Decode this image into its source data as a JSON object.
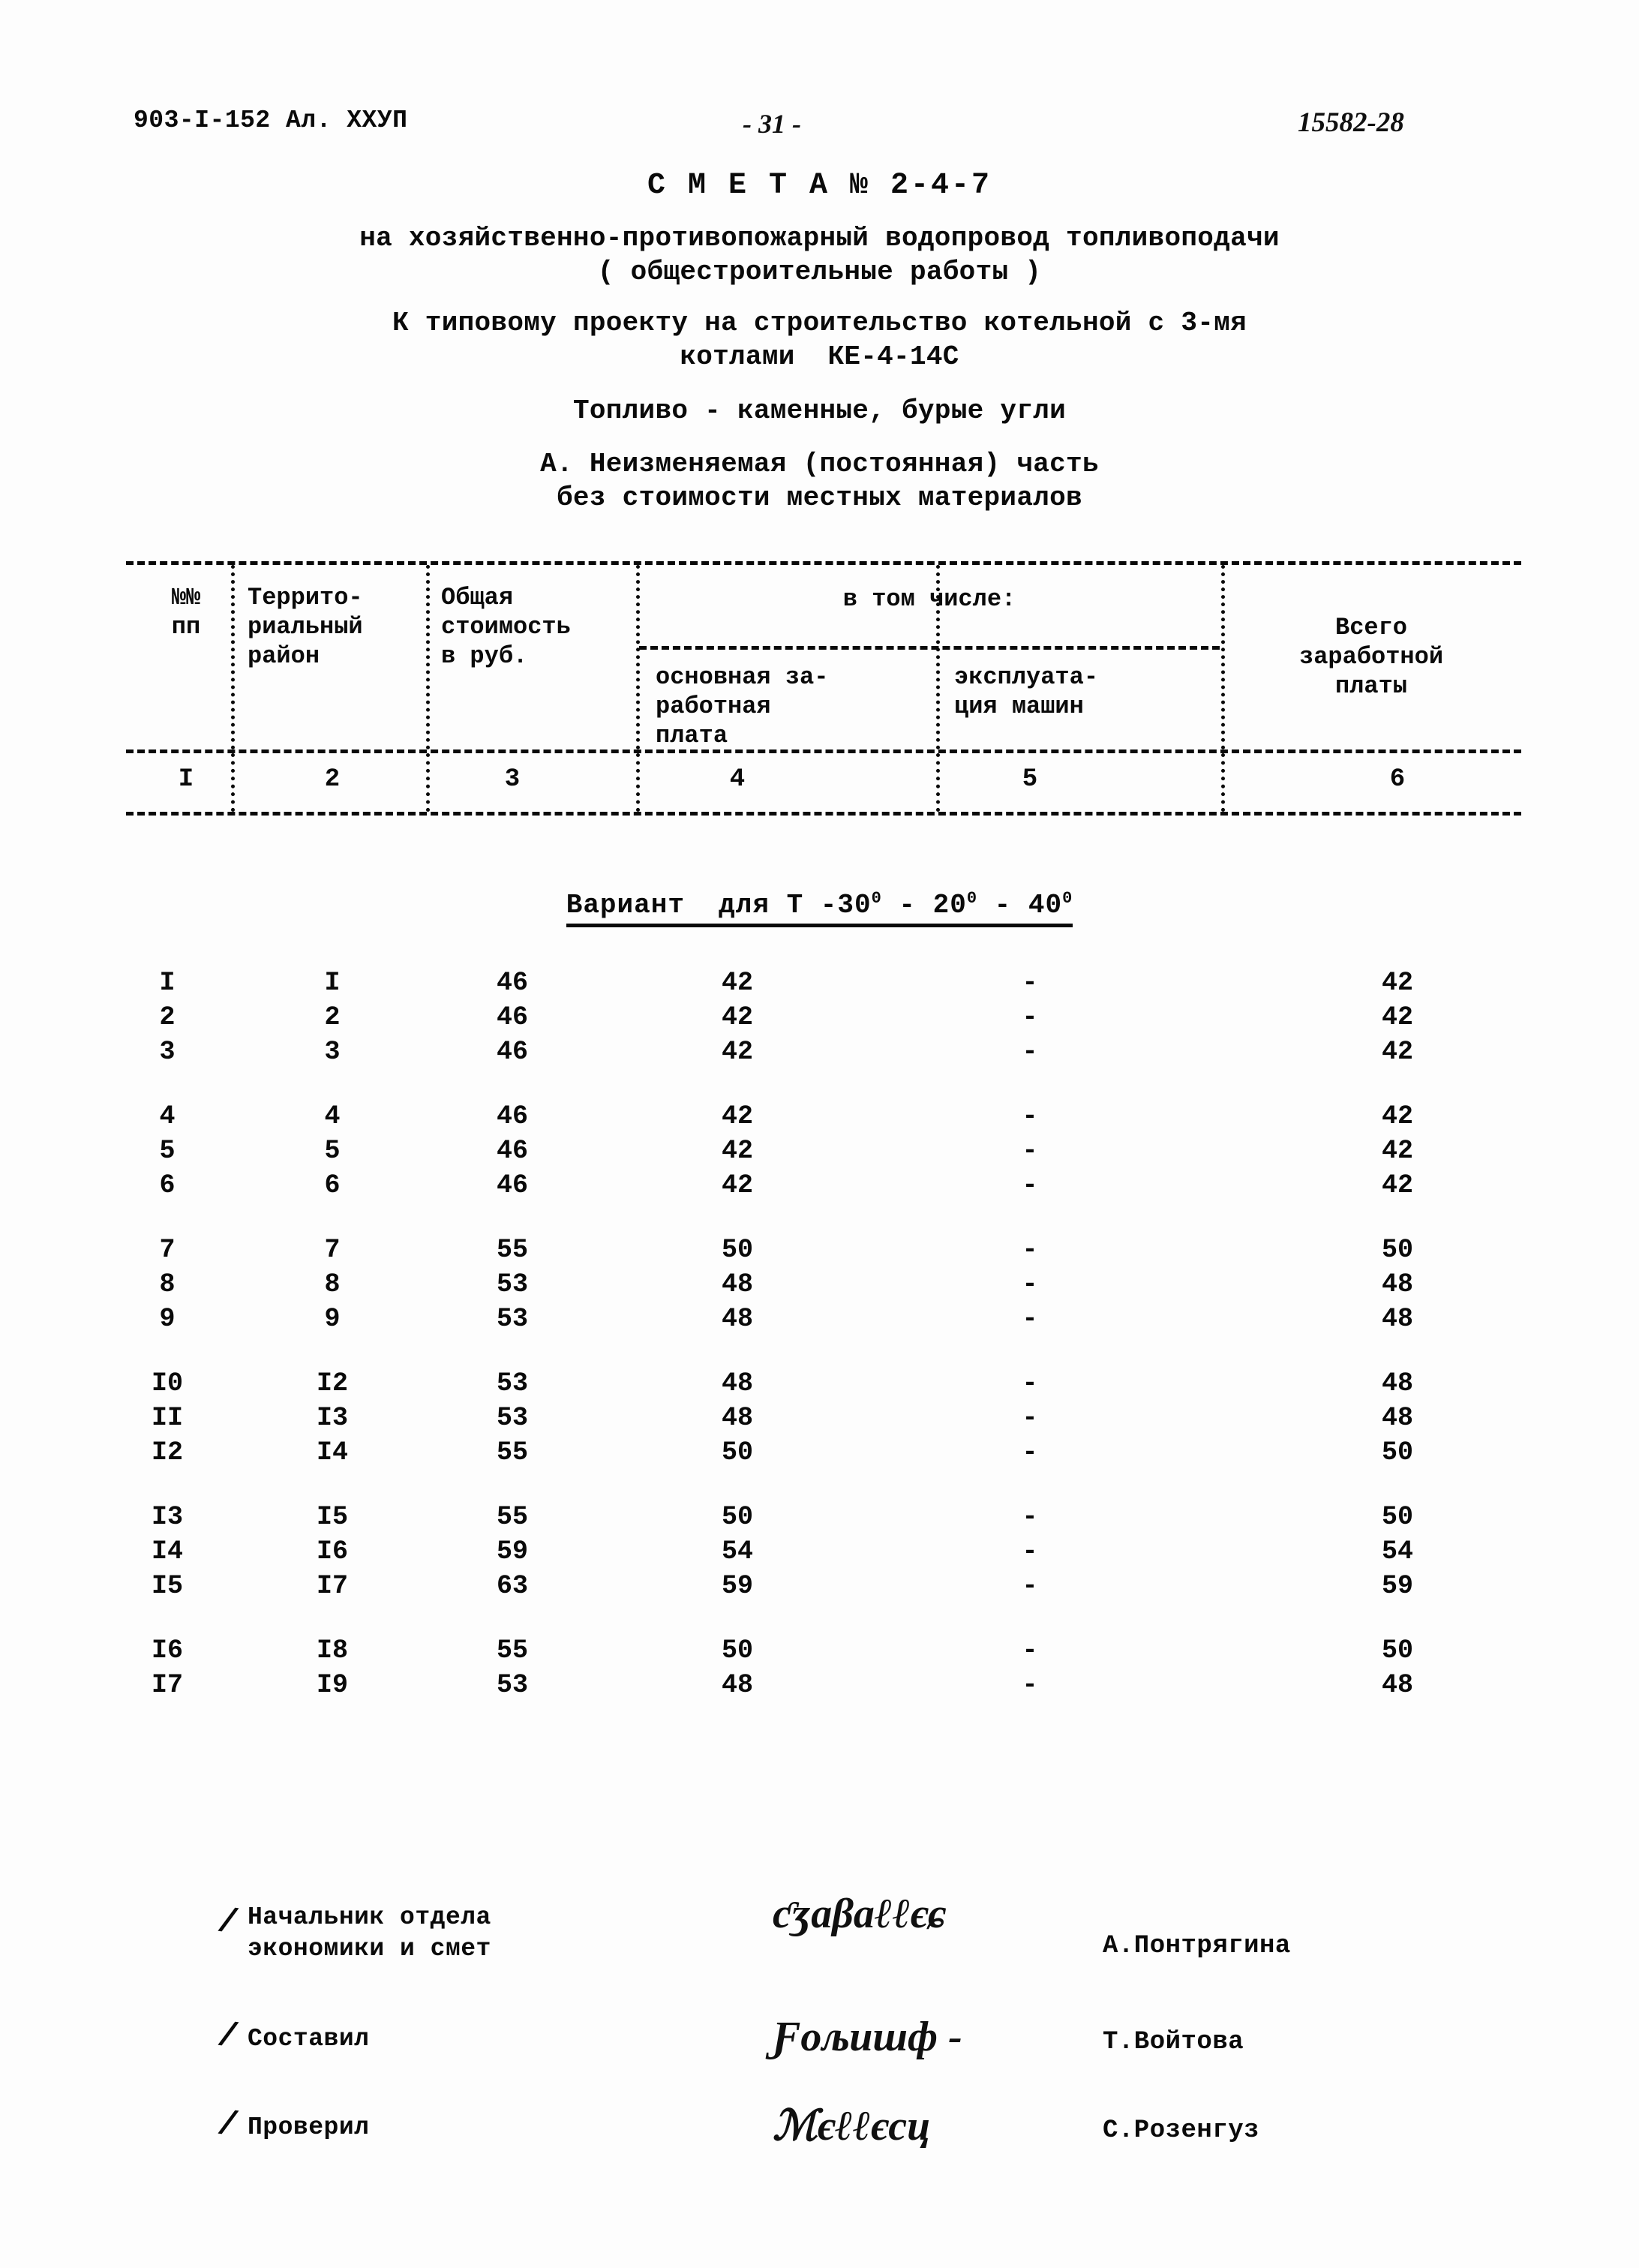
{
  "header": {
    "left": "903-I-152 Ал. ХХУП",
    "page": "- 31 -",
    "right": "15582-28"
  },
  "title": {
    "smeta": "С М Е Т А № 2-4-7",
    "line1": "на хозяйственно-противопожарный водопровод топливоподачи",
    "line2": "( общестроительные работы )",
    "line3": "К типовому проекту на строительство котельной с 3-мя",
    "line4": "котлами  КЕ-4-14С",
    "line5": "Топливо - каменные, бурые угли",
    "line6": "А. Неизменяемая (постоянная) часть",
    "line7": "без стоимости местных материалов"
  },
  "table": {
    "headers": {
      "col1": "№№\nпп",
      "col2": "Террито-\nриальный\nрайон",
      "col3": "Общая\nстоимость\nв руб.",
      "group": "в том числе:",
      "col4": "основная за-\nработная\nплата",
      "col5": "эксплуата-\nция машин",
      "col6": "Всего\nзаработной\nплаты"
    },
    "numbering": [
      "I",
      "2",
      "3",
      "4",
      "5",
      "6"
    ],
    "variant": {
      "label": "Вариант  для Т -30",
      "deg1": "0",
      "mid1": " - 20",
      "deg2": "0",
      "mid2": " - 40",
      "deg3": "0"
    },
    "groups": [
      {
        "rows": [
          {
            "no": "I",
            "region": "I",
            "total": "46",
            "wage": "42",
            "machines": "-",
            "total_wage": "42"
          },
          {
            "no": "2",
            "region": "2",
            "total": "46",
            "wage": "42",
            "machines": "-",
            "total_wage": "42"
          },
          {
            "no": "3",
            "region": "3",
            "total": "46",
            "wage": "42",
            "machines": "-",
            "total_wage": "42"
          }
        ]
      },
      {
        "rows": [
          {
            "no": "4",
            "region": "4",
            "total": "46",
            "wage": "42",
            "machines": "-",
            "total_wage": "42"
          },
          {
            "no": "5",
            "region": "5",
            "total": "46",
            "wage": "42",
            "machines": "-",
            "total_wage": "42"
          },
          {
            "no": "6",
            "region": "6",
            "total": "46",
            "wage": "42",
            "machines": "-",
            "total_wage": "42"
          }
        ]
      },
      {
        "rows": [
          {
            "no": "7",
            "region": "7",
            "total": "55",
            "wage": "50",
            "machines": "-",
            "total_wage": "50"
          },
          {
            "no": "8",
            "region": "8",
            "total": "53",
            "wage": "48",
            "machines": "-",
            "total_wage": "48"
          },
          {
            "no": "9",
            "region": "9",
            "total": "53",
            "wage": "48",
            "machines": "-",
            "total_wage": "48"
          }
        ]
      },
      {
        "rows": [
          {
            "no": "I0",
            "region": "I2",
            "total": "53",
            "wage": "48",
            "machines": "-",
            "total_wage": "48"
          },
          {
            "no": "II",
            "region": "I3",
            "total": "53",
            "wage": "48",
            "machines": "-",
            "total_wage": "48"
          },
          {
            "no": "I2",
            "region": "I4",
            "total": "55",
            "wage": "50",
            "machines": "-",
            "total_wage": "50"
          }
        ]
      },
      {
        "rows": [
          {
            "no": "I3",
            "region": "I5",
            "total": "55",
            "wage": "50",
            "machines": "-",
            "total_wage": "50"
          },
          {
            "no": "I4",
            "region": "I6",
            "total": "59",
            "wage": "54",
            "machines": "-",
            "total_wage": "54"
          },
          {
            "no": "I5",
            "region": "I7",
            "total": "63",
            "wage": "59",
            "machines": "-",
            "total_wage": "59"
          }
        ]
      },
      {
        "rows": [
          {
            "no": "I6",
            "region": "I8",
            "total": "55",
            "wage": "50",
            "machines": "-",
            "total_wage": "50"
          },
          {
            "no": "I7",
            "region": "I9",
            "total": "53",
            "wage": "48",
            "machines": "-",
            "total_wage": "48"
          }
        ]
      }
    ]
  },
  "signatures": [
    {
      "role": "Начальник отдела\nэкономики и смет",
      "scribble": "ƈʒɑβɑℓℓєɕ",
      "name": "А.Понтрягина"
    },
    {
      "role": "Составил",
      "scribble": "Ƒољишф -",
      "name": "Т.Войтова"
    },
    {
      "role": "Проверил",
      "scribble": "ℳєℓℓєсц",
      "name": "С.Розенгуз"
    }
  ]
}
